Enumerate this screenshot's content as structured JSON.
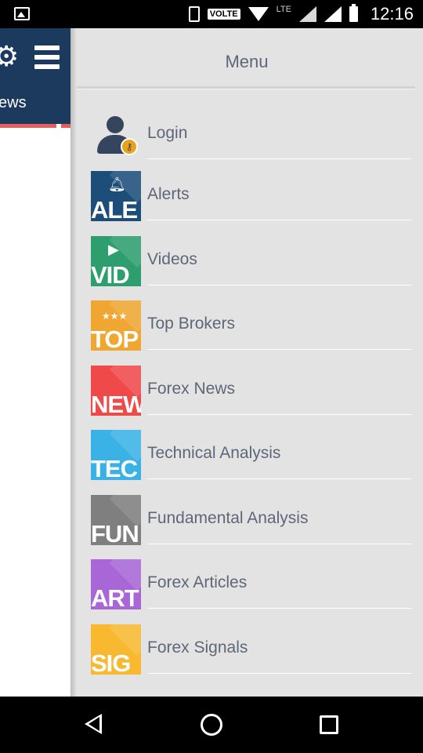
{
  "status_bar": {
    "network_badge": "VOLTE",
    "lte_label": "LTE",
    "time": "12:16",
    "icons": [
      "image-notification-icon",
      "vibrate-icon",
      "wifi-icon",
      "signal-icon",
      "battery-icon"
    ]
  },
  "background_screen": {
    "header_color": "#1c3a5e",
    "partial_title": "ews"
  },
  "drawer": {
    "title": "Menu",
    "items": [
      {
        "label": "Login",
        "thumb_text": "",
        "color": "#34455d",
        "icon": "user-key-icon"
      },
      {
        "label": "Alerts",
        "thumb_text": "ALE",
        "color": "#1d4e7a",
        "icon": "bell-icon"
      },
      {
        "label": "Videos",
        "thumb_text": "VID",
        "color": "#2e9e6e",
        "icon": "play-icon"
      },
      {
        "label": "Top Brokers",
        "thumb_text": "TOP",
        "color": "#f0a732",
        "icon": "stars-icon"
      },
      {
        "label": "Forex News",
        "thumb_text": "NEW",
        "color": "#f0494a",
        "icon": "news-icon"
      },
      {
        "label": "Technical Analysis",
        "thumb_text": "TEC",
        "color": "#3bb2e6",
        "icon": "chart-icon"
      },
      {
        "label": "Fundamental Analysis",
        "thumb_text": "FUN",
        "color": "#7f7f7f",
        "icon": "fundamental-icon"
      },
      {
        "label": "Forex Articles",
        "thumb_text": "ART",
        "color": "#a866d6",
        "icon": "article-icon"
      },
      {
        "label": "Forex Signals",
        "thumb_text": "SIG",
        "color": "#f8b930",
        "icon": "signal-icon"
      }
    ]
  },
  "nav_bar": {
    "icons": [
      "back-icon",
      "home-icon",
      "recents-icon"
    ]
  }
}
